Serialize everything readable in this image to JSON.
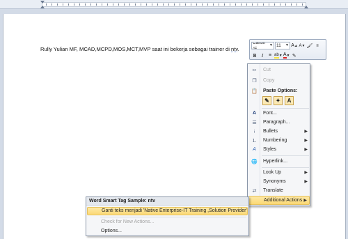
{
  "document": {
    "text_before": "Rully Yulian MF, MCAD,MCPD,MOS,MCT,MVP saat ini bekerja sebagai trainer di ",
    "smart_tag_word": "ntv",
    "text_after": "."
  },
  "mini_toolbar": {
    "font_name": "Calibri (E",
    "font_size": "11",
    "grow_font": "A",
    "shrink_font": "A",
    "bold": "B",
    "italic": "I",
    "underline": "U",
    "font_color": "A"
  },
  "context_menu": {
    "items": [
      {
        "label": "Cut",
        "icon": "scissors-icon",
        "disabled": true
      },
      {
        "label": "Copy",
        "icon": "copy-icon",
        "disabled": true
      },
      {
        "label": "Paste Options:",
        "icon": "paste-icon",
        "header": true
      },
      {
        "label": "Font...",
        "icon": "font-icon"
      },
      {
        "label": "Paragraph...",
        "icon": "paragraph-icon"
      },
      {
        "label": "Bullets",
        "icon": "bullets-icon",
        "submenu": true
      },
      {
        "label": "Numbering",
        "icon": "numbering-icon",
        "submenu": true
      },
      {
        "label": "Styles",
        "icon": "styles-icon",
        "submenu": true
      },
      {
        "label": "Hyperlink...",
        "icon": "hyperlink-icon"
      },
      {
        "label": "Look Up",
        "submenu": true
      },
      {
        "label": "Synonyms",
        "submenu": true
      },
      {
        "label": "Translate",
        "icon": "translate-icon"
      },
      {
        "label": "Additional Actions",
        "submenu": true,
        "active": true
      }
    ],
    "paste_buttons": [
      "A"
    ]
  },
  "smart_tag_menu": {
    "title": "Word Smart Tag Sample: ntv",
    "items": [
      {
        "label": "Ganti teks menjadi 'Native Enterprise-IT Training ,Solution Provider'",
        "active": true
      },
      {
        "label": "Check for New Actions...",
        "disabled": true
      },
      {
        "label": "Options..."
      }
    ]
  },
  "colors": {
    "highlight": "#fbd874",
    "font_color_bar": "#e02020",
    "highlight_bar": "#f5e33a"
  }
}
